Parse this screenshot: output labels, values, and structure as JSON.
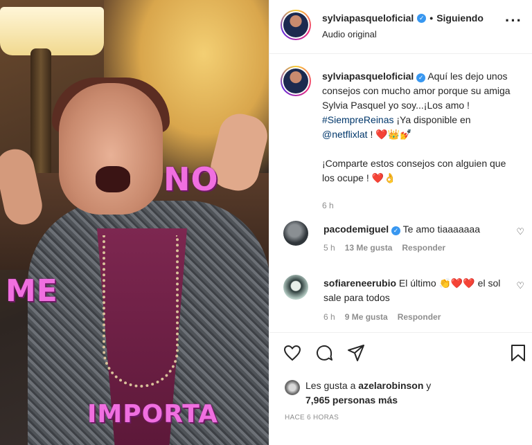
{
  "media": {
    "overlay_words": [
      "NO",
      "ME",
      "IMPORTA"
    ]
  },
  "header": {
    "username": "sylviapasqueloficial",
    "verified_icon": "verified-badge-icon",
    "separator": "•",
    "follow_state": "Siguiendo",
    "audio": "Audio original",
    "more_icon": "more-icon"
  },
  "caption": {
    "username": "sylviapasqueloficial",
    "text_1": "Aquí les dejo unos consejos con mucho amor porque su amiga Sylvia Pasquel yo soy...¡Los amo ! ",
    "hashtag": "#SiempreReinas",
    "text_2": " ¡Ya disponible en ",
    "mention": "@netflixlat",
    "text_3": " ! ❤️👑💅",
    "text_4": "¡Comparte estos consejos con alguien que los ocupe ! ❤️👌",
    "time": "6 h"
  },
  "comments": [
    {
      "username": "pacodemiguel",
      "verified": true,
      "text": "Te amo tiaaaaaaa",
      "time": "5 h",
      "likes": "13 Me gusta",
      "reply": "Responder"
    },
    {
      "username": "sofiareneerubio",
      "verified": false,
      "text": "El último 👏❤️❤️ el sol sale para todos",
      "time": "6 h",
      "likes": "9 Me gusta",
      "reply": "Responder"
    }
  ],
  "actions": {
    "like_icon": "heart-icon",
    "comment_icon": "comment-icon",
    "share_icon": "share-icon",
    "save_icon": "bookmark-icon"
  },
  "likes": {
    "prefix": "Les gusta a ",
    "user": "azelarobinson",
    "conj": " y",
    "others": "7,965 personas más"
  },
  "posted": "HACE 6 HORAS",
  "colors": {
    "link": "#00376b",
    "verified": "#3897f0",
    "muted": "#8e8e8e",
    "overlay_text": "#f06fe0"
  }
}
